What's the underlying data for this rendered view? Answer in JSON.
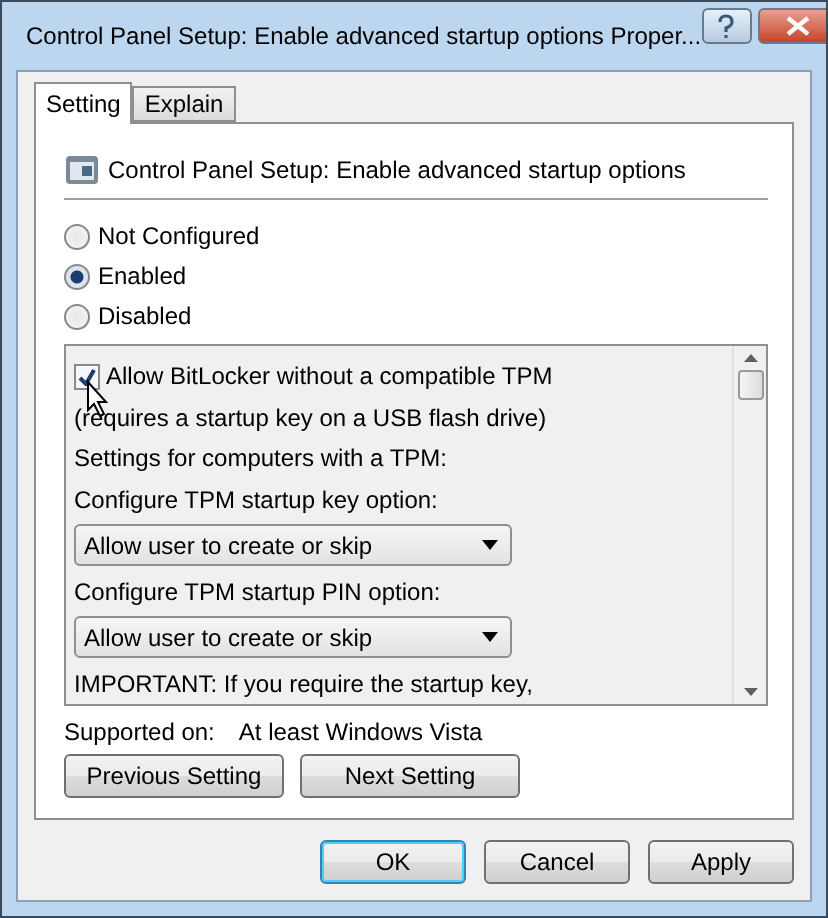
{
  "window": {
    "title": "Control Panel Setup: Enable advanced startup options Proper..."
  },
  "tabs": [
    {
      "label": "Setting",
      "selected": true
    },
    {
      "label": "Explain",
      "selected": false
    }
  ],
  "policy": {
    "name": "Control Panel Setup: Enable advanced startup options"
  },
  "options": [
    {
      "label": "Not Configured",
      "selected": false
    },
    {
      "label": "Enabled",
      "selected": true
    },
    {
      "label": "Disabled",
      "selected": false
    }
  ],
  "settings": [
    {
      "kind": "checkbox",
      "label": "Allow BitLocker without a compatible TPM",
      "checked": true
    },
    {
      "kind": "text",
      "label": "(requires a startup key on a USB flash drive)"
    },
    {
      "kind": "text",
      "label": "Settings for computers with a TPM:"
    },
    {
      "kind": "text",
      "label": "Configure TPM startup key option:"
    },
    {
      "kind": "dropdown",
      "value": "Allow user to create or skip"
    },
    {
      "kind": "text",
      "label": "Configure TPM startup PIN option:"
    },
    {
      "kind": "dropdown",
      "value": "Allow user to create or skip"
    },
    {
      "kind": "text",
      "label": "IMPORTANT: If you require the startup key,"
    }
  ],
  "supported": {
    "label": "Supported on:",
    "value": "At least Windows Vista"
  },
  "nav_buttons": [
    "Previous Setting",
    "Next Setting"
  ],
  "buttons": [
    {
      "label": "OK",
      "default": true
    },
    {
      "label": "Cancel",
      "default": false
    },
    {
      "label": "Apply",
      "default": false
    }
  ]
}
